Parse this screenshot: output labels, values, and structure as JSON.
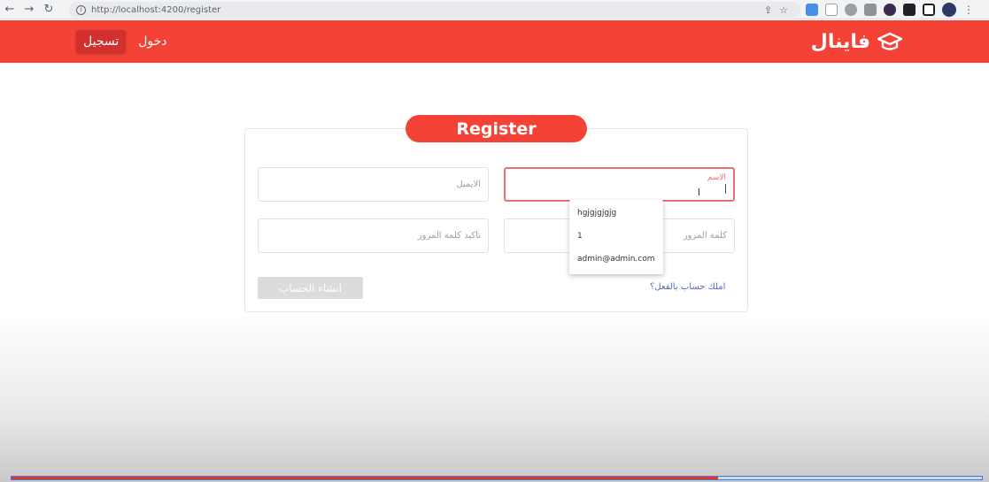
{
  "browser": {
    "url": "http://localhost:4200/register",
    "back_icon": "←",
    "forward_icon": "→",
    "reload_icon": "↻",
    "info_icon": "i",
    "share_icon": "⇪",
    "star_icon": "☆",
    "menu_icon": "⋮"
  },
  "navbar": {
    "brand": "فاينال",
    "brand_icon": "graduation-cap-icon",
    "links": [
      {
        "label": "دخول"
      },
      {
        "label": "تسجيل"
      }
    ]
  },
  "form": {
    "title": "Register",
    "name_placeholder": "الاسم",
    "email_placeholder": "الايميل",
    "password_placeholder": "كلمة المرور",
    "confirm_password_placeholder": "تاكيد كلمة المرور",
    "submit_label": "انشاء الحساب",
    "login_link": "املك حساب بالفعل؟"
  },
  "autocomplete": {
    "options": [
      "hgjgjgjgjg",
      "1",
      "admin@admin.com"
    ]
  },
  "video_progress": {
    "fraction": 0.728
  },
  "colors": {
    "primary": "#f44336",
    "primary_dark": "#d32f2f",
    "link": "#5c6bc0"
  }
}
